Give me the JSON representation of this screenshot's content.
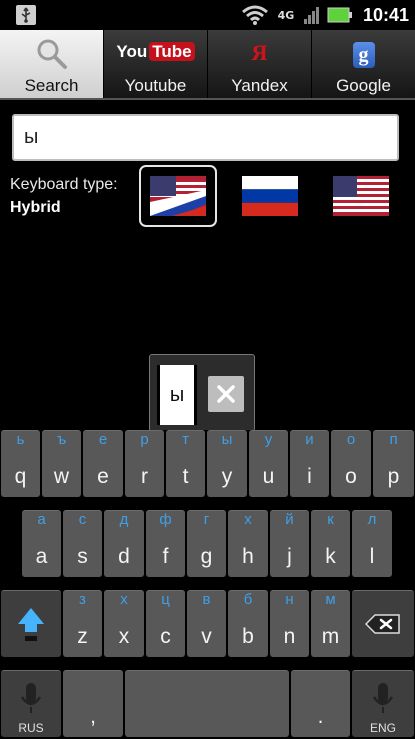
{
  "status_bar": {
    "time": "10:41",
    "network": "4G",
    "icons": [
      "usb-icon",
      "wifi-icon",
      "4g-icon",
      "signal-icon",
      "battery-icon"
    ],
    "battery_color": "#5fd13a"
  },
  "tabs": [
    {
      "label": "Search",
      "icon": "search-icon",
      "active": true
    },
    {
      "label": "Youtube",
      "icon": "youtube-logo",
      "logo_text_1": "You",
      "logo_text_2": "Tube",
      "active": false
    },
    {
      "label": "Yandex",
      "icon": "yandex-logo",
      "logo_text": "Я",
      "active": false
    },
    {
      "label": "Google",
      "icon": "google-logo",
      "logo_text": "g",
      "active": false
    }
  ],
  "search": {
    "value": "ы",
    "placeholder": ""
  },
  "keyboard_type": {
    "label": "Keyboard type:",
    "value": "Hybrid"
  },
  "flags": [
    {
      "name": "hybrid-flag",
      "selected": true
    },
    {
      "name": "russia-flag",
      "selected": false
    },
    {
      "name": "usa-flag",
      "selected": false
    }
  ],
  "candidate": {
    "text": "ы"
  },
  "keyboard": {
    "row1": [
      {
        "ru": "ь",
        "en": "q"
      },
      {
        "ru": "ъ",
        "en": "w"
      },
      {
        "ru": "е",
        "en": "e"
      },
      {
        "ru": "р",
        "en": "r"
      },
      {
        "ru": "т",
        "en": "t"
      },
      {
        "ru": "ы",
        "en": "y"
      },
      {
        "ru": "у",
        "en": "u"
      },
      {
        "ru": "и",
        "en": "i"
      },
      {
        "ru": "о",
        "en": "o"
      },
      {
        "ru": "п",
        "en": "p"
      }
    ],
    "row2": [
      {
        "ru": "а",
        "en": "a"
      },
      {
        "ru": "с",
        "en": "s"
      },
      {
        "ru": "д",
        "en": "d"
      },
      {
        "ru": "ф",
        "en": "f"
      },
      {
        "ru": "г",
        "en": "g"
      },
      {
        "ru": "х",
        "en": "h"
      },
      {
        "ru": "й",
        "en": "j"
      },
      {
        "ru": "к",
        "en": "k"
      },
      {
        "ru": "л",
        "en": "l"
      }
    ],
    "row3": [
      {
        "ru": "з",
        "en": "z"
      },
      {
        "ru": "х",
        "en": "x"
      },
      {
        "ru": "ц",
        "en": "c"
      },
      {
        "ru": "в",
        "en": "v"
      },
      {
        "ru": "б",
        "en": "b"
      },
      {
        "ru": "н",
        "en": "n"
      },
      {
        "ru": "м",
        "en": "m"
      }
    ],
    "bottom": {
      "left_caption": "RUS",
      "comma": ",",
      "period": ".",
      "right_caption": "ENG"
    },
    "ru_color": "#3f9fe6",
    "key_color": "#585858"
  }
}
